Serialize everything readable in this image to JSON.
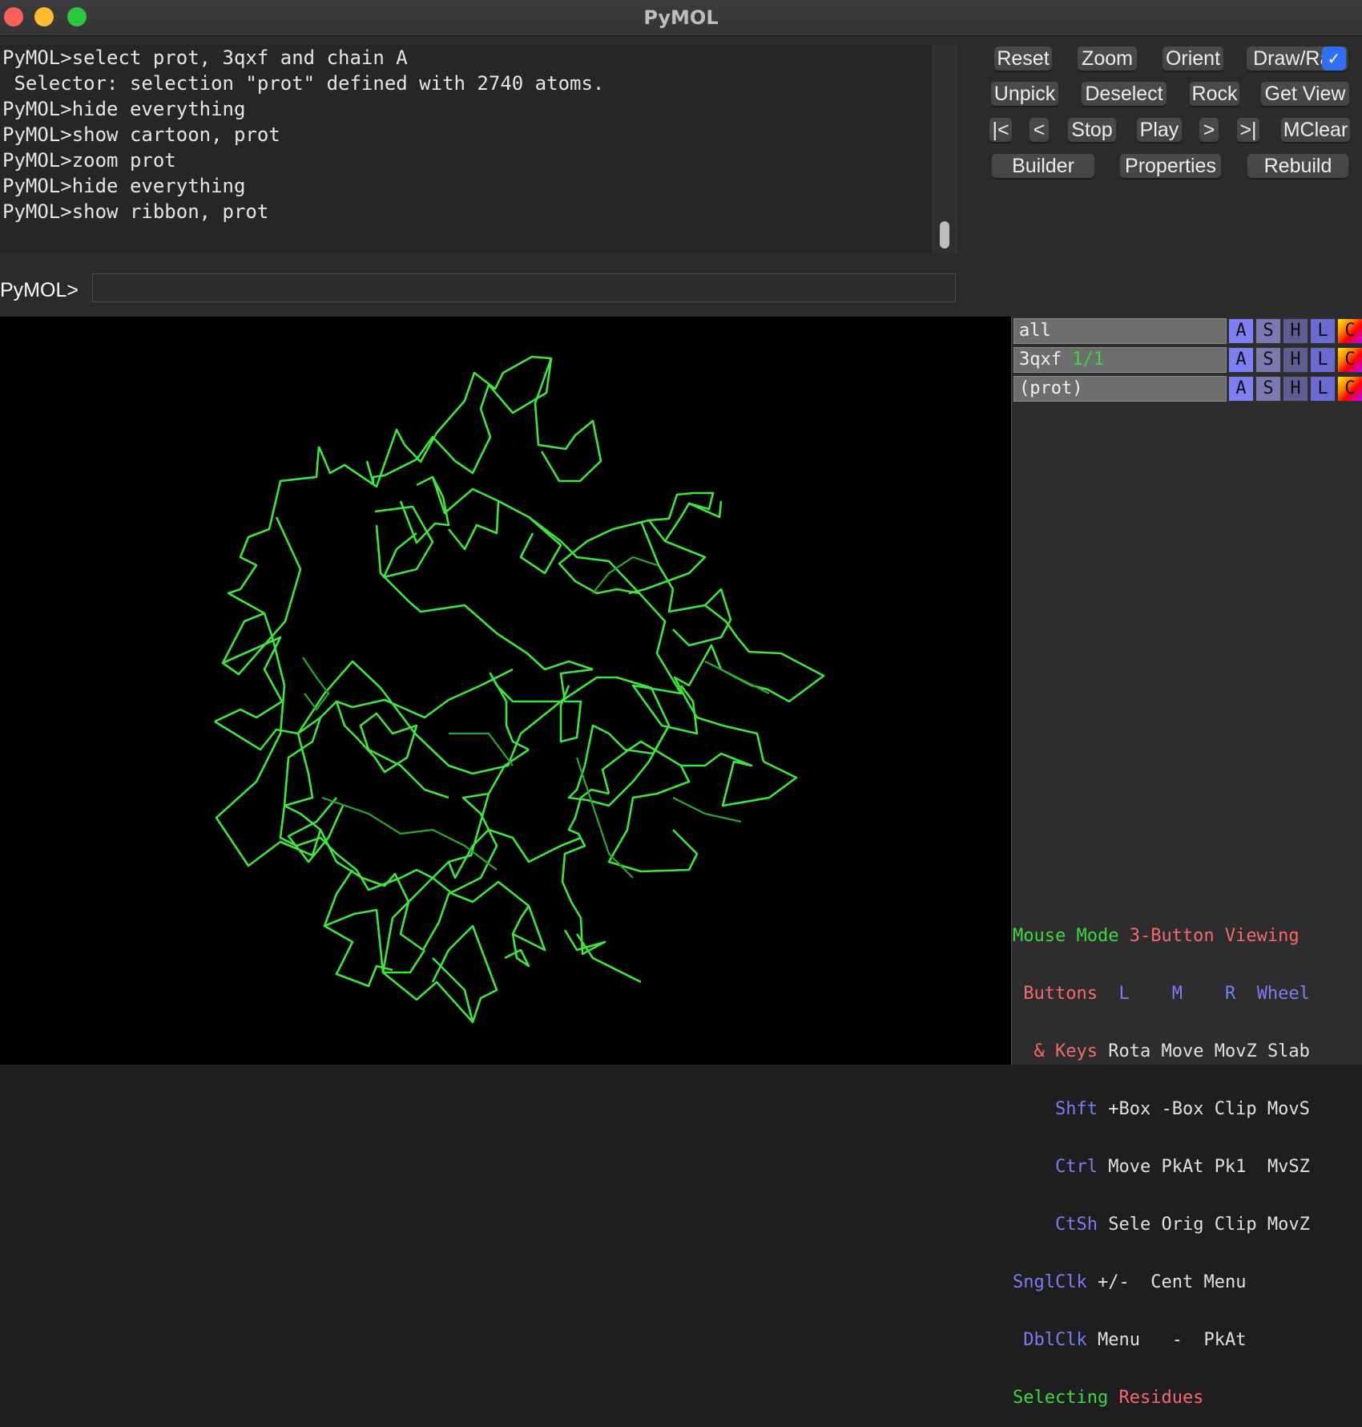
{
  "window": {
    "title": "PyMOL"
  },
  "console": {
    "lines": [
      "PyMOL>select prot, 3qxf and chain A",
      " Selector: selection \"prot\" defined with 2740 atoms.",
      "PyMOL>hide everything",
      "PyMOL>show cartoon, prot",
      "PyMOL>zoom prot",
      "PyMOL>hide everything",
      "PyMOL>show ribbon, prot"
    ]
  },
  "command": {
    "prompt": "PyMOL>",
    "value": ""
  },
  "buttons": {
    "reset": "Reset",
    "zoom": "Zoom",
    "orient": "Orient",
    "draw_ray": "Draw/Ray",
    "unpick": "Unpick",
    "deselect": "Deselect",
    "rock": "Rock",
    "get_view": "Get View",
    "first": "|<",
    "prev": "<",
    "stop": "Stop",
    "play": "Play",
    "next": ">",
    "last": ">|",
    "mclear": "MClear",
    "builder": "Builder",
    "properties": "Properties",
    "rebuild": "Rebuild"
  },
  "objects": [
    {
      "name": "all",
      "state": ""
    },
    {
      "name": "3qxf",
      "state": "1/1"
    },
    {
      "name": "(prot)",
      "state": ""
    }
  ],
  "object_buttons": {
    "a": "A",
    "s": "S",
    "h": "H",
    "l": "L",
    "c": "C"
  },
  "mouse": {
    "mode_label": "Mouse Mode",
    "mode_value": "3-Button Viewing",
    "buttons_label": "Buttons",
    "col_l": "L",
    "col_m": "M",
    "col_r": "R",
    "col_wheel": "Wheel",
    "keys_label": "& Keys",
    "keys_row": [
      "Rota",
      "Move",
      "MovZ",
      "Slab"
    ],
    "shft_label": "Shft",
    "shft_row": [
      "+Box",
      "-Box",
      "Clip",
      "MovS"
    ],
    "ctrl_label": "Ctrl",
    "ctrl_row": [
      "Move",
      "PkAt",
      "Pk1",
      "MvSZ"
    ],
    "ctsh_label": "CtSh",
    "ctsh_row": [
      "Sele",
      "Orig",
      "Clip",
      "MovZ"
    ],
    "snglclk_label": "SnglClk",
    "snglclk_row": [
      "+/-",
      "Cent",
      "Menu"
    ],
    "dblclk_label": "DblClk",
    "dblclk_row": [
      "Menu",
      "-",
      "PkAt"
    ],
    "selecting_label": "Selecting",
    "selecting_value": "Residues"
  },
  "colors": {
    "ribbon": "#3de63d",
    "accent_green": "#3cd93c",
    "accent_pink": "#f46a6a",
    "accent_blue": "#7c7cf6"
  }
}
